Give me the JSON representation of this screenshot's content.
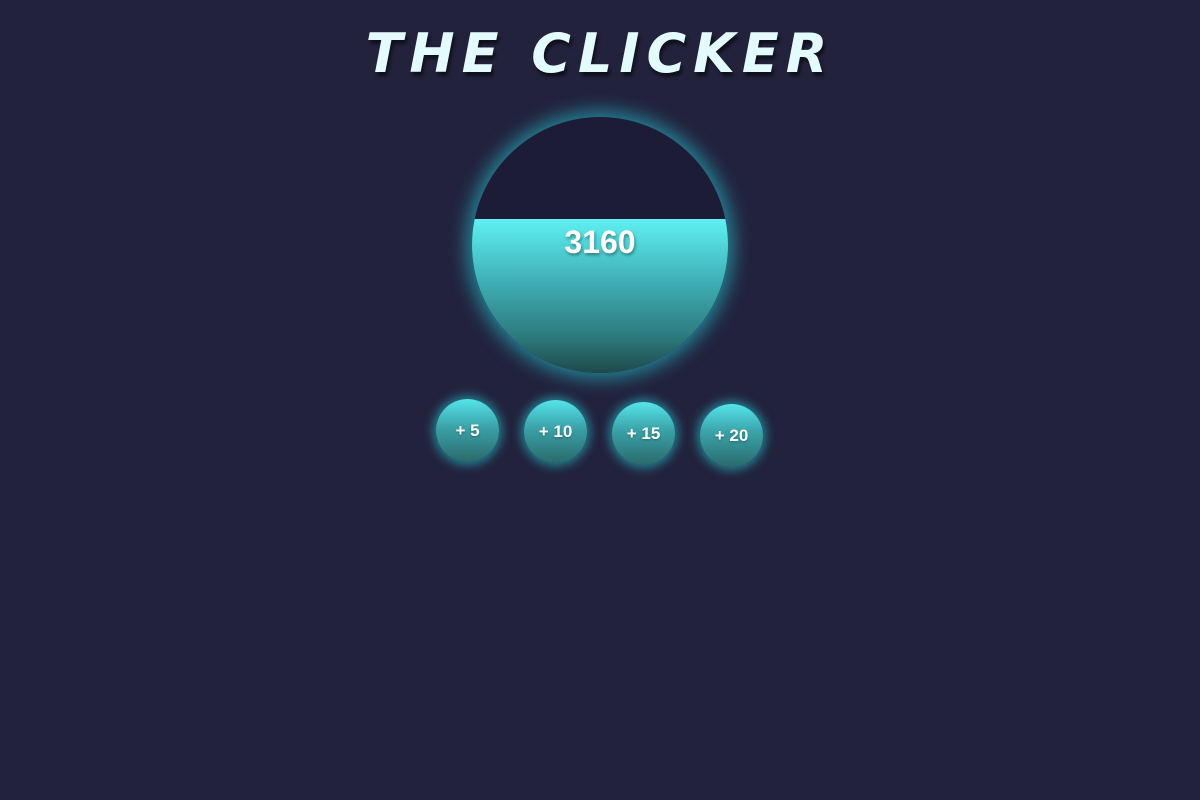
{
  "title": "THE CLICKER",
  "counter": {
    "value": "3160",
    "fill_fraction": 0.6
  },
  "buttons": [
    {
      "label": "+ 5"
    },
    {
      "label": "+ 10"
    },
    {
      "label": "+ 15"
    },
    {
      "label": "+ 20"
    }
  ],
  "colors": {
    "background": "#22223d",
    "accent": "#5ff0f2",
    "glow": "#26d4de"
  }
}
